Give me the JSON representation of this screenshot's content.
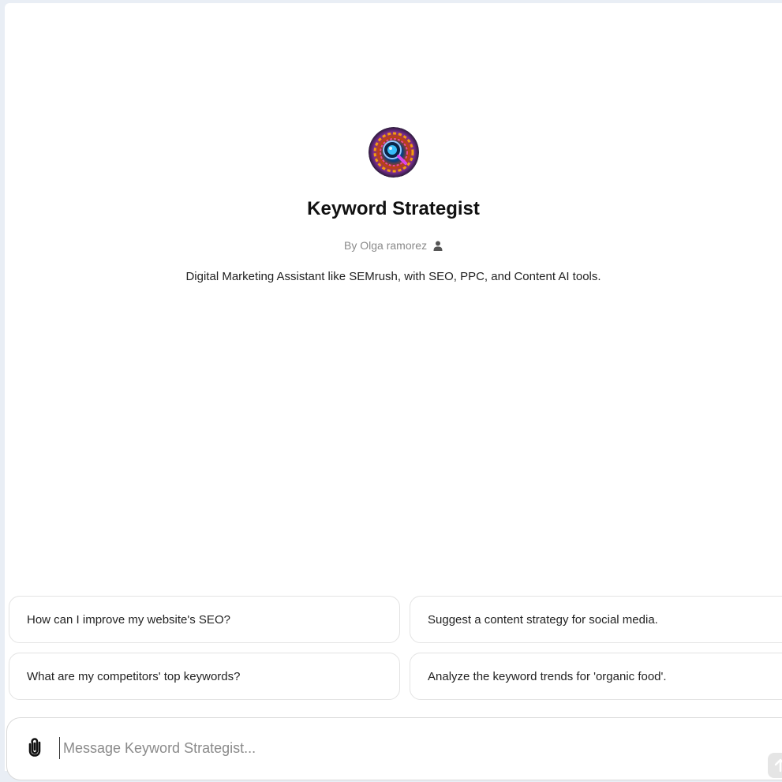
{
  "gpt": {
    "name": "Keyword Strategist",
    "author": "By Olga ramorez",
    "description": "Digital Marketing Assistant like SEMrush, with SEO, PPC, and Content AI tools."
  },
  "suggestions": [
    "How can I improve my website's SEO?",
    "Suggest a content strategy for social media.",
    "What are my competitors' top keywords?",
    "Analyze the keyword trends for 'organic food'."
  ],
  "composer": {
    "placeholder": "Message Keyword Strategist..."
  },
  "icons": {
    "attach": "paperclip-icon",
    "author": "person-icon",
    "send": "arrow-up-icon"
  }
}
